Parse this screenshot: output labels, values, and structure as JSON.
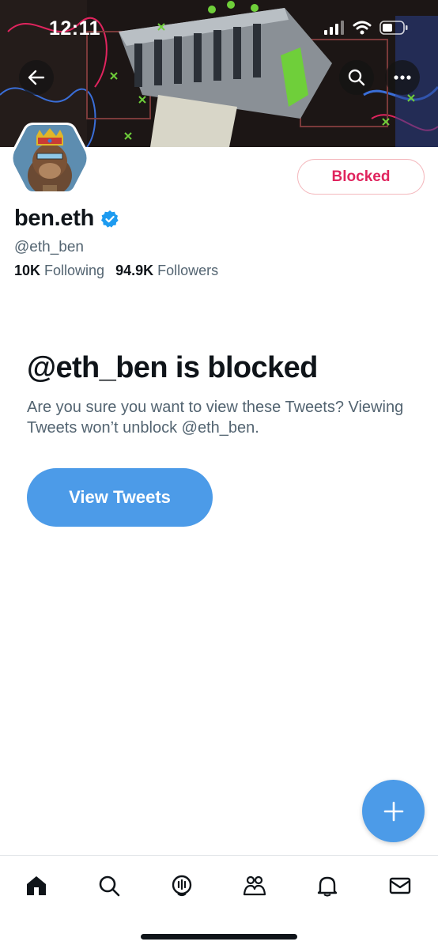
{
  "status_bar": {
    "time": "12:11"
  },
  "profile": {
    "display_name": "ben.eth",
    "handle": "@eth_ben",
    "following_count": "10K",
    "following_label": "Following",
    "followers_count": "94.9K",
    "followers_label": "Followers",
    "blocked_button_label": "Blocked"
  },
  "blocked_notice": {
    "title": "@eth_ben is blocked",
    "description": "Are you sure you want to view these Tweets? Viewing Tweets won’t unblock @eth_ben.",
    "view_button_label": "View Tweets"
  },
  "bottom_nav": {
    "items": [
      {
        "name": "home",
        "icon": "home-icon"
      },
      {
        "name": "search",
        "icon": "search-icon"
      },
      {
        "name": "spaces",
        "icon": "spaces-icon"
      },
      {
        "name": "communities",
        "icon": "communities-icon"
      },
      {
        "name": "notifications",
        "icon": "bell-icon"
      },
      {
        "name": "messages",
        "icon": "mail-icon"
      }
    ]
  },
  "colors": {
    "accent": "#4c9be8",
    "blocked_red": "#e0245e",
    "text_primary": "#0f1419",
    "text_secondary": "#536471",
    "verified_blue": "#1d9bf0"
  }
}
